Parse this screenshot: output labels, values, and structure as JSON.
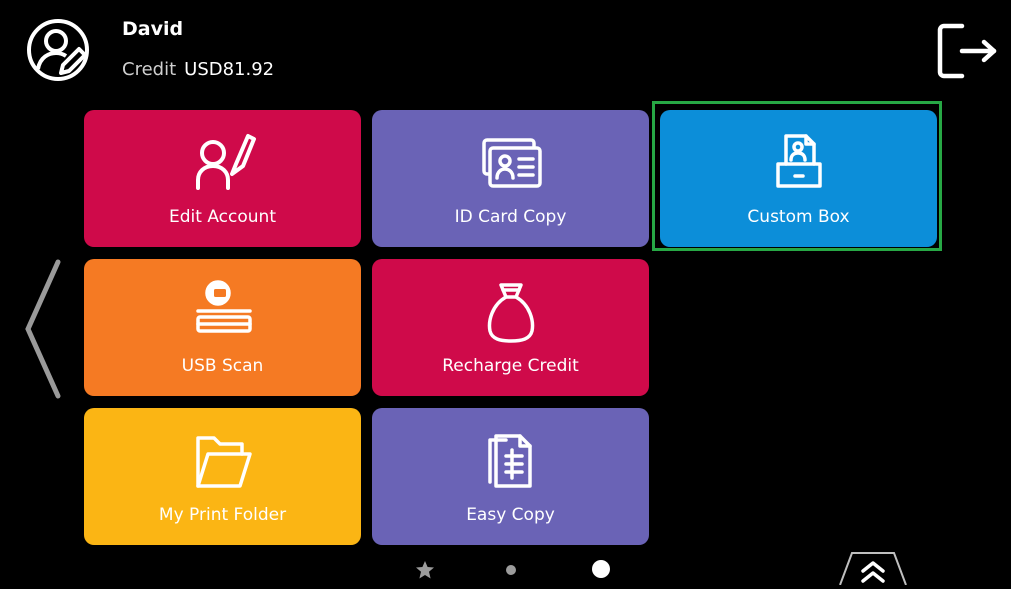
{
  "user": {
    "name": "David",
    "credit_label": "Credit",
    "credit_value": "USD81.92"
  },
  "icons": {
    "avatar": "user-edit-icon",
    "logout": "logout-icon",
    "back": "chevron-left-icon",
    "expand": "double-chevron-up-icon"
  },
  "tiles": [
    {
      "label": "Edit Account",
      "icon": "user-pen-icon",
      "color": "#cf0a4a"
    },
    {
      "label": "ID Card Copy",
      "icon": "id-card-icon",
      "color": "#6a63b6"
    },
    {
      "label": "Custom Box",
      "icon": "custom-box-icon",
      "color": "#0c8ed9",
      "selected": true
    },
    {
      "label": "USB Scan",
      "icon": "usb-scanner-icon",
      "color": "#f57a23"
    },
    {
      "label": "Recharge Credit",
      "icon": "money-bag-icon",
      "color": "#cf0a4a"
    },
    {
      "label": "My Print Folder",
      "icon": "folder-icon",
      "color": "#fbb514"
    },
    {
      "label": "Easy Copy",
      "icon": "copy-documents-icon",
      "color": "#6a63b6"
    }
  ],
  "pager": {
    "pages": 3,
    "current": 3
  },
  "colors": {
    "highlight": "#27a845",
    "background": "#000000"
  }
}
